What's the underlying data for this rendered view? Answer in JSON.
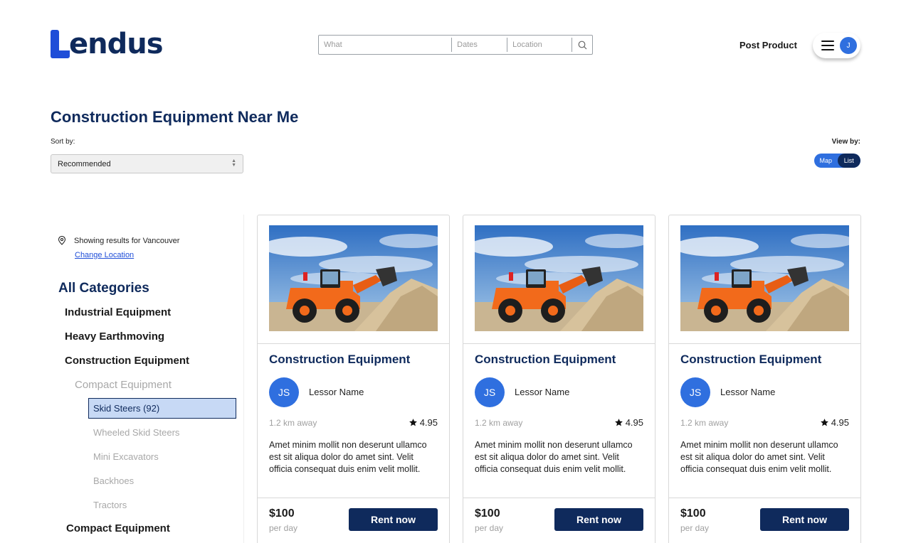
{
  "brand": {
    "logo_text": "endus"
  },
  "search": {
    "what_placeholder": "What",
    "dates_placeholder": "Dates",
    "location_placeholder": "Location"
  },
  "nav": {
    "post_product": "Post Product",
    "avatar_initial": "J"
  },
  "page": {
    "title": "Construction Equipment Near Me",
    "sort_label": "Sort by:",
    "sort_value": "Recommended",
    "view_label": "View by:",
    "view_options": [
      "Map",
      "List"
    ]
  },
  "sidebar": {
    "location_text": "Showing results for Vancouver",
    "change_location": "Change Location",
    "categories_title": "All Categories",
    "cat_industrial": "Industrial Equipment",
    "cat_heavy": "Heavy Earthmoving",
    "cat_construction": "Construction Equipment",
    "cat_compact_sub": "Compact Equipment",
    "cat_skid_steers": "Skid Steers (92)",
    "cat_wheeled": "Wheeled Skid Steers",
    "cat_mini": "Mini Excavators",
    "cat_backhoes": "Backhoes",
    "cat_tractors": "Tractors",
    "cat_compact": "Compact Equipment"
  },
  "cards": [
    {
      "title": "Construction Equipment",
      "initials": "JS",
      "lessor": "Lessor Name",
      "distance": "1.2 km away",
      "rating": "4.95",
      "description": "Amet minim mollit non deserunt ullamco est sit aliqua dolor do amet sint. Velit officia consequat duis enim velit mollit.",
      "price": "$100",
      "per": "per day",
      "cta": "Rent now"
    },
    {
      "title": "Construction Equipment",
      "initials": "JS",
      "lessor": "Lessor Name",
      "distance": "1.2 km away",
      "rating": "4.95",
      "description": "Amet minim mollit non deserunt ullamco est sit aliqua dolor do amet sint. Velit officia consequat duis enim velit mollit.",
      "price": "$100",
      "per": "per day",
      "cta": "Rent now"
    },
    {
      "title": "Construction Equipment",
      "initials": "JS",
      "lessor": "Lessor Name",
      "distance": "1.2 km away",
      "rating": "4.95",
      "description": "Amet minim mollit non deserunt ullamco est sit aliqua dolor do amet sint. Velit officia consequat duis enim velit mollit.",
      "price": "$100",
      "per": "per day",
      "cta": "Rent now"
    }
  ],
  "colors": {
    "brand_navy": "#0f2a5c",
    "brand_blue": "#1f4ed8",
    "accent_blue": "#2f6fdf",
    "selected_bg": "#c7d9f5"
  },
  "icons": [
    "search-icon",
    "menu-icon",
    "location-pin-icon",
    "star-icon",
    "chevron-updown-icon"
  ]
}
